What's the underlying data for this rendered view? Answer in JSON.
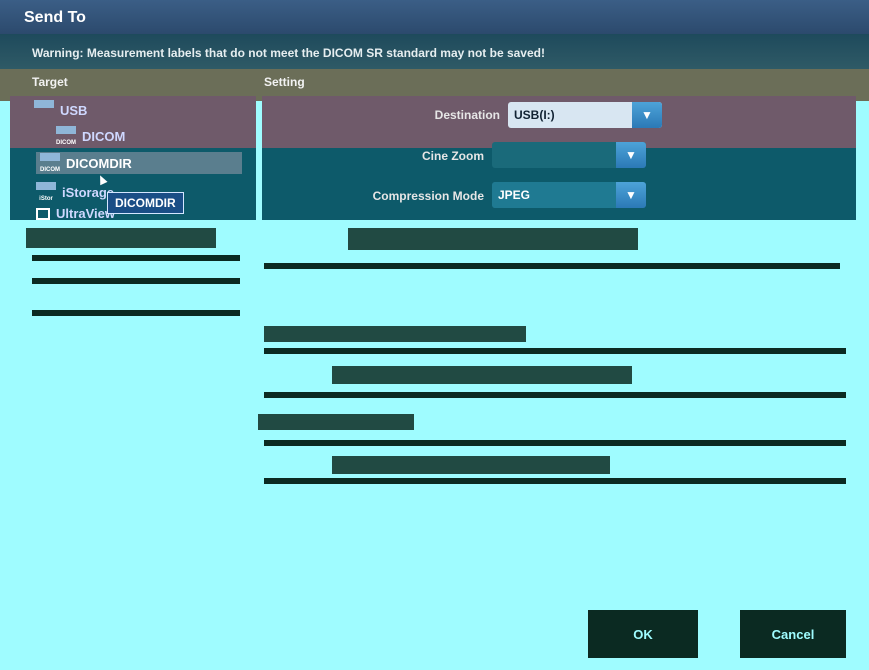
{
  "window": {
    "title": "Send To"
  },
  "warning": "Warning: Measurement labels that do not meet the DICOM SR standard may not be saved!",
  "columns": {
    "target": "Target",
    "setting": "Setting"
  },
  "targets": [
    {
      "label": "USB",
      "icon": "usb-icon"
    },
    {
      "label": "DICOM",
      "icon": "dicom-icon"
    },
    {
      "label": "DICOMDIR",
      "icon": "dicomdir-icon",
      "selected": true
    },
    {
      "label": "iStorage",
      "icon": "istorage-icon"
    },
    {
      "label": "UltraView",
      "icon": "monitor-icon"
    }
  ],
  "tooltip": "DICOMDIR",
  "settings": {
    "destination_label": "Destination",
    "destination_value": "USB(I:)",
    "cine_zoom_label": "Cine Zoom",
    "cine_zoom_value": "",
    "compression_label": "Compression Mode",
    "compression_value": "JPEG"
  },
  "buttons": {
    "ok": "OK",
    "cancel": "Cancel"
  },
  "colors": {
    "title_bar": "#2c4a6d",
    "background": "#9ffcff",
    "accent": "#2b79b6"
  }
}
